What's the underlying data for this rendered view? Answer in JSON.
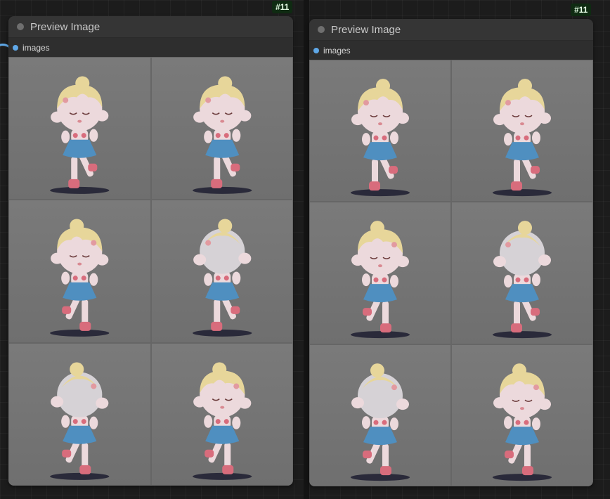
{
  "nodes": [
    {
      "id_badge": "#11",
      "title": "Preview Image",
      "output_label": "images",
      "images": [
        {
          "view": "front",
          "description": "chibi figure front view"
        },
        {
          "view": "front-right",
          "description": "chibi figure three-quarter view"
        },
        {
          "view": "left",
          "description": "chibi figure side view"
        },
        {
          "view": "back",
          "description": "chibi figure back view"
        },
        {
          "view": "back-left",
          "description": "chibi figure back three-quarter view"
        },
        {
          "view": "front-left",
          "description": "chibi figure three-quarter view"
        }
      ]
    },
    {
      "id_badge": "#11",
      "title": "Preview Image",
      "output_label": "images",
      "images": [
        {
          "view": "front",
          "description": "chibi figure front view"
        },
        {
          "view": "front-right",
          "description": "chibi figure three-quarter view"
        },
        {
          "view": "left",
          "description": "chibi figure side view"
        },
        {
          "view": "back",
          "description": "chibi figure back view"
        },
        {
          "view": "back-left",
          "description": "chibi figure back three-quarter view"
        },
        {
          "view": "front-left",
          "description": "chibi figure three-quarter view"
        }
      ]
    }
  ],
  "colors": {
    "canvas": "#1c1c1c",
    "node_body": "#353535",
    "badge_bg": "#0f2b12",
    "slot_dot": "#5fa8e8",
    "image_bg": "#747474",
    "hair": "#e7d69a",
    "skin": "#ecd9dc",
    "dress": "#4f8fc0",
    "boots": "#d86c7c",
    "base": "#2a2a3a"
  }
}
